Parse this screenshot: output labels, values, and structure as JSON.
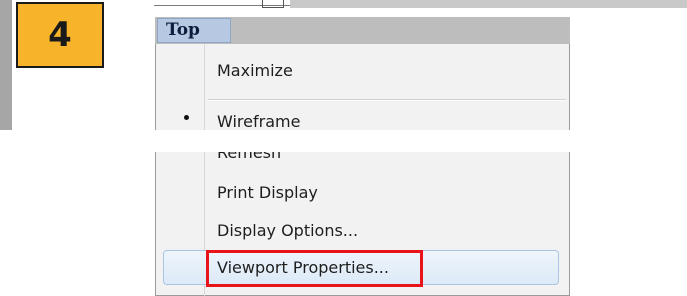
{
  "step": {
    "number": "4",
    "badge_color": "#f7b329"
  },
  "viewport": {
    "title": "Top"
  },
  "menu": {
    "items": [
      {
        "label": "Maximize"
      },
      {
        "label": "Wireframe",
        "selected": true
      },
      {
        "label": "Remesh"
      },
      {
        "label": "Print Display"
      },
      {
        "label": "Display Options..."
      },
      {
        "label": "Viewport Properties...",
        "highlighted": true
      }
    ]
  },
  "callout": {
    "color": "#e8141a",
    "target": "Viewport Properties..."
  },
  "icons": {
    "selected_marker": "bullet-icon"
  }
}
